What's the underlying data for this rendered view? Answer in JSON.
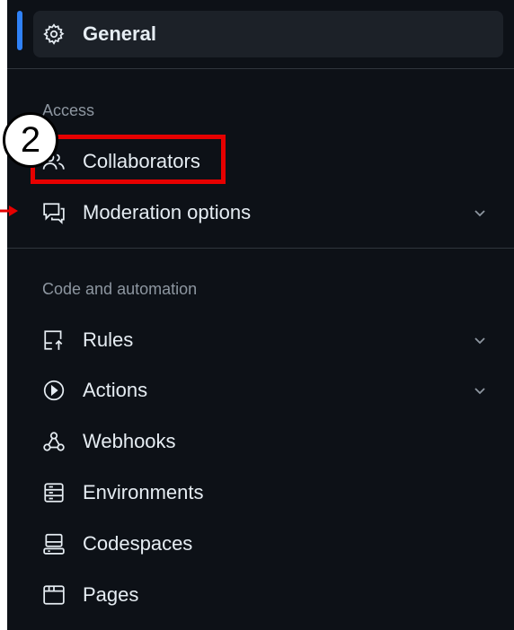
{
  "nav": {
    "general": {
      "label": "General",
      "icon": "gear-icon"
    },
    "sections": {
      "access": "Access",
      "code_automation": "Code and automation"
    },
    "items": {
      "collaborators": {
        "label": "Collaborators",
        "icon": "people-icon"
      },
      "moderation": {
        "label": "Moderation options",
        "icon": "report-icon"
      },
      "rules": {
        "label": "Rules",
        "icon": "rules-icon"
      },
      "actions": {
        "label": "Actions",
        "icon": "play-icon"
      },
      "webhooks": {
        "label": "Webhooks",
        "icon": "webhook-icon"
      },
      "environments": {
        "label": "Environments",
        "icon": "server-icon"
      },
      "codespaces": {
        "label": "Codespaces",
        "icon": "codespaces-icon"
      },
      "pages": {
        "label": "Pages",
        "icon": "browser-icon"
      }
    }
  },
  "annotation": {
    "step_number": "2"
  },
  "colors": {
    "background": "#0d1117",
    "active_item": "#1c2128",
    "accent": "#2f81f7",
    "text": "#e6edf3",
    "muted": "#8d96a0",
    "annotation_red": "#e60000"
  }
}
